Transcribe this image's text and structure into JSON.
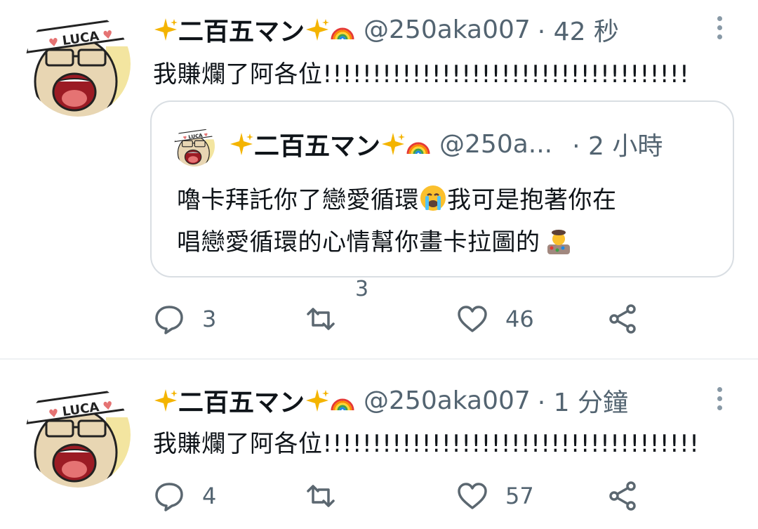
{
  "tweets": [
    {
      "name": "二百五マン",
      "handle": "@250aka007",
      "time": "· 42 秒",
      "text": "我賺爛了阿各位!!!!!!!!!!!!!!!!!!!!!!!!!!!!!!!!!!!!!",
      "quote": {
        "name": "二百五マン",
        "handle": "@250a...",
        "time": "· 2 小時",
        "line1": "嚕卡拜託你了戀愛循環",
        "line1b": "我可是抱著你在",
        "line2": "唱戀愛循環的心情幫你畫卡拉圖的"
      },
      "floating_count": "3",
      "replies": "3",
      "retweets": "",
      "likes": "46"
    },
    {
      "name": "二百五マン",
      "handle": "@250aka007",
      "time": "· 1 分鐘",
      "text": "我賺爛了阿各位!!!!!!!!!!!!!!!!!!!!!!!!!!!!!!!!!!!!!!",
      "replies": "4",
      "retweets": "",
      "likes": "57"
    }
  ],
  "avatar_band_text": "LUCA",
  "colors": {
    "secondary": "#536471",
    "icon": "#5b6770",
    "divider": "#eef1f3"
  }
}
